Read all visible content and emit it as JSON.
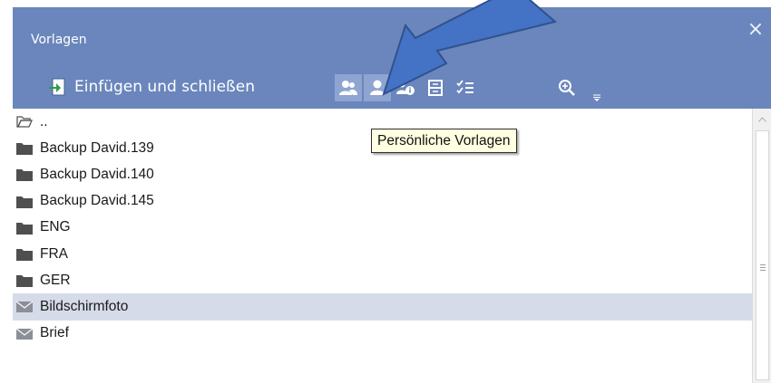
{
  "window": {
    "title": "Vorlagen",
    "close_icon": "close-icon"
  },
  "toolbar": {
    "insert_label": "Einfügen und schließen",
    "buttons": [
      {
        "name": "shared-templates",
        "icon": "users-icon"
      },
      {
        "name": "personal-templates",
        "icon": "user-icon"
      },
      {
        "name": "template-info",
        "icon": "user-info-icon"
      },
      {
        "name": "save-template",
        "icon": "save-icon"
      },
      {
        "name": "checklist",
        "icon": "checklist-icon"
      },
      {
        "name": "zoom-search",
        "icon": "zoom-icon"
      }
    ]
  },
  "tooltip": {
    "text": "Persönliche Vorlagen"
  },
  "list": {
    "items": [
      {
        "label": "..",
        "icon": "folder-open-icon"
      },
      {
        "label": "Backup David.139",
        "icon": "folder-icon"
      },
      {
        "label": "Backup David.140",
        "icon": "folder-icon"
      },
      {
        "label": "Backup David.145",
        "icon": "folder-icon"
      },
      {
        "label": "ENG",
        "icon": "folder-icon"
      },
      {
        "label": "FRA",
        "icon": "folder-icon"
      },
      {
        "label": "GER",
        "icon": "folder-icon"
      },
      {
        "label": "Bildschirmfoto",
        "icon": "mail-icon",
        "selected": true
      },
      {
        "label": "Brief",
        "icon": "mail-icon"
      }
    ]
  },
  "colors": {
    "header": "#6a86bc",
    "selection": "#d5dbe8",
    "annotation_arrow": "#4472c4",
    "tooltip_bg": "#ffffe1"
  }
}
